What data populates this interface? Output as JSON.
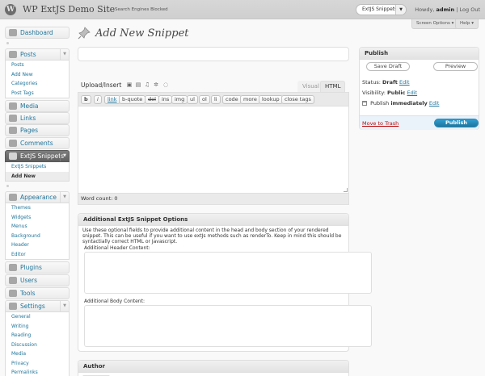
{
  "header": {
    "logo": "W",
    "site_title": "WP ExtJS Demo Site",
    "visibility": "Search Engines Blocked",
    "favorites_selected": "ExtJS Snippets",
    "howdy": "Howdy,",
    "username": "admin",
    "separator": "|",
    "logout": "Log Out"
  },
  "screen_meta": {
    "screen_options": "Screen Options ▾",
    "help": "Help ▾"
  },
  "sidebar": {
    "dashboard": "Dashboard",
    "posts": {
      "label": "Posts",
      "items": [
        "Posts",
        "Add New",
        "Categories",
        "Post Tags"
      ]
    },
    "media": "Media",
    "links": "Links",
    "pages": "Pages",
    "comments": "Comments",
    "extjs": {
      "label": "ExtJS Snippets",
      "items": [
        "ExtJS Snippets",
        "Add New"
      ]
    },
    "appearance": {
      "label": "Appearance",
      "items": [
        "Themes",
        "Widgets",
        "Menus",
        "Background",
        "Header",
        "Editor"
      ]
    },
    "plugins": "Plugins",
    "users": "Users",
    "tools": "Tools",
    "settings": {
      "label": "Settings",
      "items": [
        "General",
        "Writing",
        "Reading",
        "Discussion",
        "Media",
        "Privacy",
        "Permalinks"
      ]
    }
  },
  "page": {
    "title": "Add New Snippet",
    "title_value": ""
  },
  "editor": {
    "upload_insert": "Upload/Insert",
    "tabs": [
      "Visual",
      "HTML"
    ],
    "active_tab": "HTML",
    "quicktags": [
      "b",
      "i",
      "link",
      "b-quote",
      "del",
      "ins",
      "img",
      "ul",
      "ol",
      "li",
      "code",
      "more",
      "lookup",
      "close tags"
    ],
    "content": "",
    "word_count": "Word count: 0"
  },
  "snippet_options": {
    "title": "Additional ExtJS Snippet Options",
    "description": "Use these optional fields to provide additional content in the head and body section of your rendered snippet. This can be useful if you want to use extJs methods such as renderTo. Keep in mind this should be syntactially correct HTML or Javascript.",
    "header_label": "Additional Header Content:",
    "header_value": "",
    "body_label": "Additional Body Content:",
    "body_value": ""
  },
  "author": {
    "title": "Author"
  },
  "publish": {
    "title": "Publish",
    "save_draft": "Save Draft",
    "preview": "Preview",
    "status_label": "Status:",
    "status_value": "Draft",
    "visibility_label": "Visibility:",
    "visibility_value": "Public",
    "schedule_label": "Publish",
    "schedule_value": "immediately",
    "edit": "Edit",
    "trash": "Move to Trash",
    "publish_button": "Publish"
  },
  "colors": {
    "link": "#21759b",
    "trash": "#bc0b0b",
    "publish": "#21759b"
  }
}
